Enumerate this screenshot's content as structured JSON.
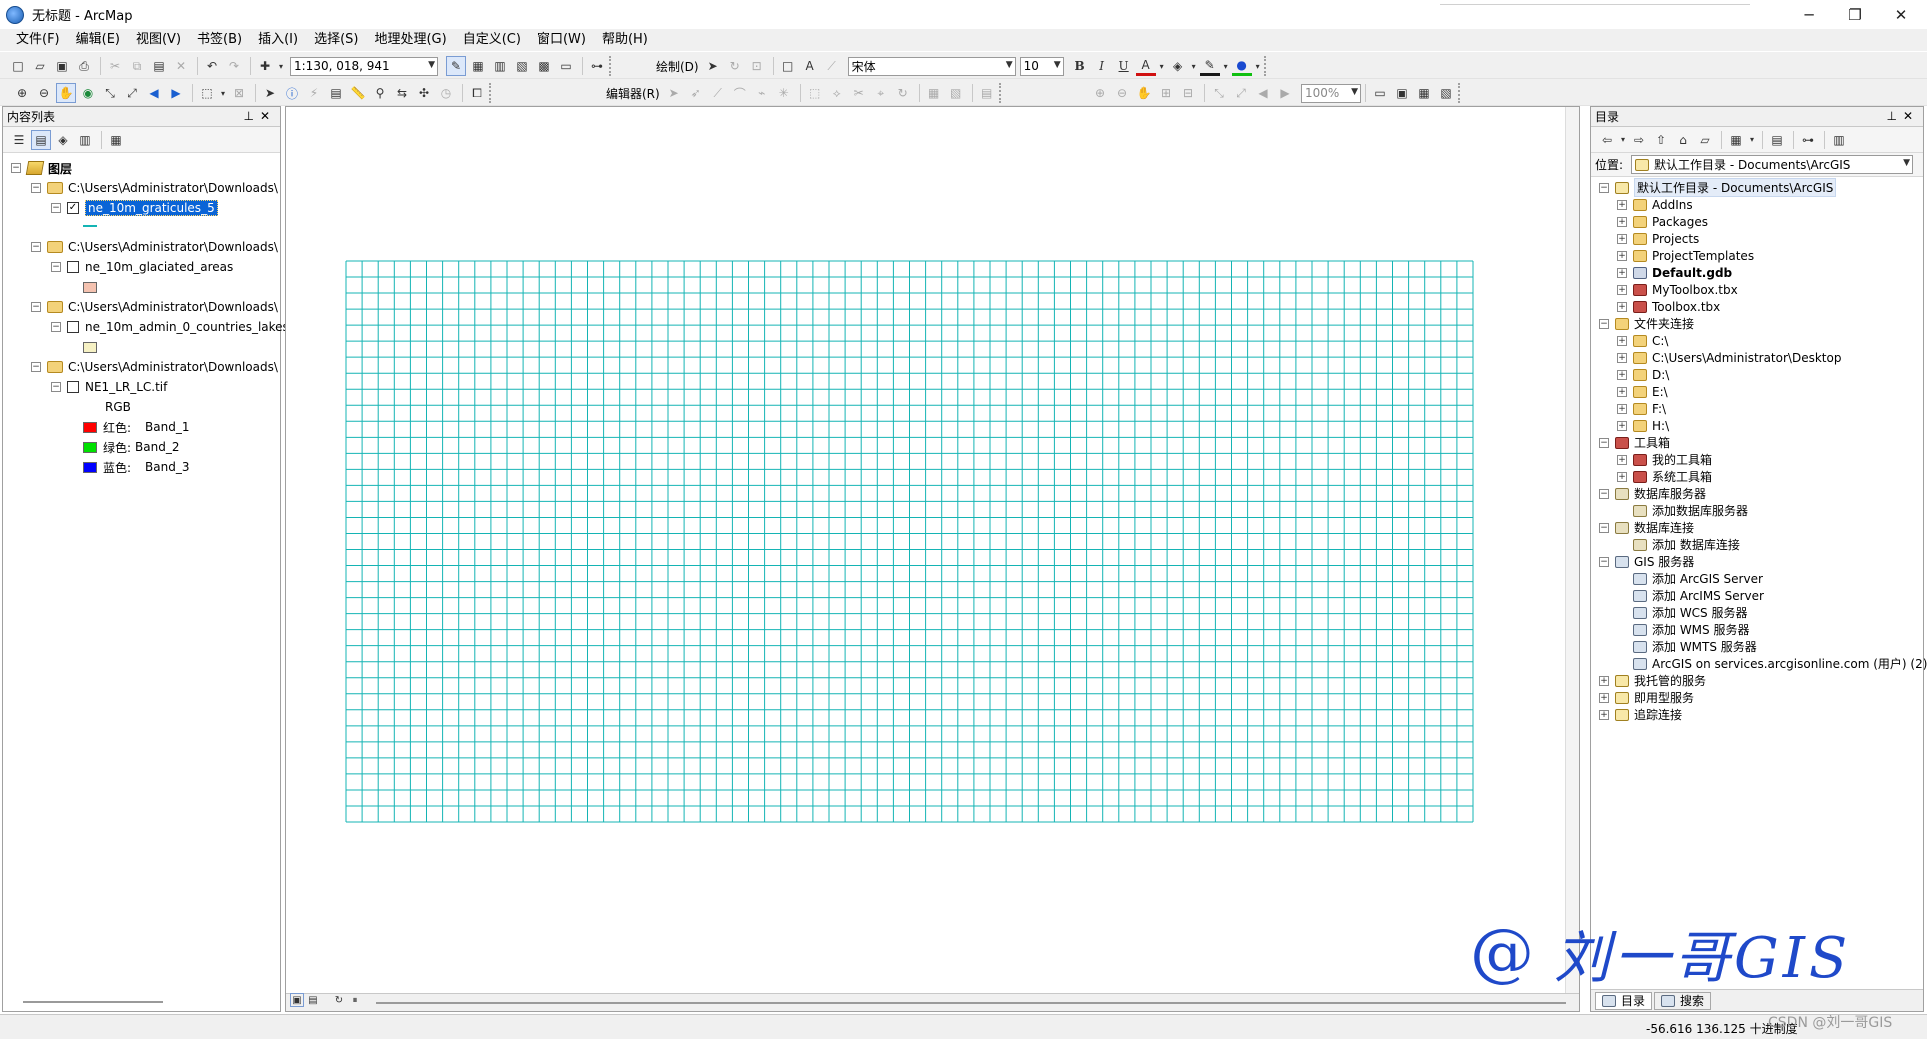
{
  "window": {
    "title": "无标题 - ArcMap",
    "controls": [
      "─",
      "❐",
      "✕"
    ]
  },
  "menu": [
    "文件(F)",
    "编辑(E)",
    "视图(V)",
    "书签(B)",
    "插入(I)",
    "选择(S)",
    "地理处理(G)",
    "自定义(C)",
    "窗口(W)",
    "帮助(H)"
  ],
  "toolbar": {
    "scale": "1:130, 018, 941",
    "draw_label": "绘制(D)",
    "font_name": "宋体",
    "font_size": "10",
    "bold": "B",
    "italic": "I",
    "underline": "U",
    "editor_label": "编辑器(R)",
    "zoom_percent": "100%"
  },
  "toc": {
    "title": "内容列表",
    "root": "图层",
    "groups": [
      {
        "path": "C:\\Users\\Administrator\\Downloads\\",
        "layer": "ne_10m_graticules_5",
        "checked": true,
        "symbol_color": "#14b4b4"
      },
      {
        "path": "C:\\Users\\Administrator\\Downloads\\",
        "layer": "ne_10m_glaciated_areas",
        "checked": false,
        "symbol_color": "#f4c2b0"
      },
      {
        "path": "C:\\Users\\Administrator\\Downloads\\",
        "layer": "ne_10m_admin_0_countries_lakes",
        "checked": false,
        "symbol_color": "#f6f1c4"
      },
      {
        "path": "C:\\Users\\Administrator\\Downloads\\",
        "layer": "NE1_LR_LC.tif",
        "checked": false,
        "symbol_color": ""
      }
    ],
    "raster_legend": {
      "label": "RGB",
      "bands": [
        {
          "channel": "红色:",
          "band": "Band_1",
          "color": "#ff0000"
        },
        {
          "channel": "绿色:",
          "band": "Band_2",
          "color": "#00e000"
        },
        {
          "channel": "蓝色:",
          "band": "Band_3",
          "color": "#0000ff"
        }
      ]
    }
  },
  "map": {
    "graticule_color": "#14b4b4",
    "columns": 70,
    "rows": 35
  },
  "catalog": {
    "title": "目录",
    "location_label": "位置:",
    "location_value": "默认工作目录 - Documents\\ArcGIS",
    "tree": [
      {
        "text": "默认工作目录 - Documents\\ArcGIS",
        "level": 0,
        "expander": "−",
        "icon": "hot",
        "highlight": true
      },
      {
        "text": "AddIns",
        "level": 1,
        "expander": "+",
        "icon": "folder"
      },
      {
        "text": "Packages",
        "level": 1,
        "expander": "+",
        "icon": "folder"
      },
      {
        "text": "Projects",
        "level": 1,
        "expander": "+",
        "icon": "folder"
      },
      {
        "text": "ProjectTemplates",
        "level": 1,
        "expander": "+",
        "icon": "folder"
      },
      {
        "text": "Default.gdb",
        "level": 1,
        "expander": "+",
        "icon": "gdb",
        "bold": true
      },
      {
        "text": "MyToolbox.tbx",
        "level": 1,
        "expander": "+",
        "icon": "tbx"
      },
      {
        "text": "Toolbox.tbx",
        "level": 1,
        "expander": "+",
        "icon": "tbx"
      },
      {
        "text": "文件夹连接",
        "level": 0,
        "expander": "−",
        "icon": "folder"
      },
      {
        "text": "C:\\",
        "level": 1,
        "expander": "+",
        "icon": "folder"
      },
      {
        "text": "C:\\Users\\Administrator\\Desktop",
        "level": 1,
        "expander": "+",
        "icon": "folder"
      },
      {
        "text": "D:\\",
        "level": 1,
        "expander": "+",
        "icon": "folder"
      },
      {
        "text": "E:\\",
        "level": 1,
        "expander": "+",
        "icon": "folder"
      },
      {
        "text": "F:\\",
        "level": 1,
        "expander": "+",
        "icon": "folder"
      },
      {
        "text": "H:\\",
        "level": 1,
        "expander": "+",
        "icon": "folder"
      },
      {
        "text": "工具箱",
        "level": 0,
        "expander": "−",
        "icon": "tbx"
      },
      {
        "text": "我的工具箱",
        "level": 1,
        "expander": "+",
        "icon": "tbx"
      },
      {
        "text": "系统工具箱",
        "level": 1,
        "expander": "+",
        "icon": "tbx"
      },
      {
        "text": "数据库服务器",
        "level": 0,
        "expander": "−",
        "icon": "db"
      },
      {
        "text": "添加数据库服务器",
        "level": 1,
        "expander": "",
        "icon": "db"
      },
      {
        "text": "数据库连接",
        "level": 0,
        "expander": "−",
        "icon": "db"
      },
      {
        "text": "添加 数据库连接",
        "level": 1,
        "expander": "",
        "icon": "db"
      },
      {
        "text": "GIS 服务器",
        "level": 0,
        "expander": "−",
        "icon": "srv"
      },
      {
        "text": "添加 ArcGIS Server",
        "level": 1,
        "expander": "",
        "icon": "srv"
      },
      {
        "text": "添加 ArcIMS Server",
        "level": 1,
        "expander": "",
        "icon": "srv"
      },
      {
        "text": "添加 WCS 服务器",
        "level": 1,
        "expander": "",
        "icon": "srv"
      },
      {
        "text": "添加 WMS 服务器",
        "level": 1,
        "expander": "",
        "icon": "srv"
      },
      {
        "text": "添加 WMTS 服务器",
        "level": 1,
        "expander": "",
        "icon": "srv"
      },
      {
        "text": "ArcGIS on services.arcgisonline.com (用户) (2)",
        "level": 1,
        "expander": "",
        "icon": "srv"
      },
      {
        "text": "我托管的服务",
        "level": 0,
        "expander": "+",
        "icon": "hot"
      },
      {
        "text": "即用型服务",
        "level": 0,
        "expander": "+",
        "icon": "hot"
      },
      {
        "text": "追踪连接",
        "level": 0,
        "expander": "+",
        "icon": "hot"
      }
    ],
    "tabs": [
      "目录",
      "搜索"
    ]
  },
  "status": {
    "coordinates": "-56.616  136.125 十进制度"
  },
  "watermark": {
    "at": "@",
    "name": "刘一哥GIS",
    "csdn": "CSDN @刘一哥GIS"
  }
}
